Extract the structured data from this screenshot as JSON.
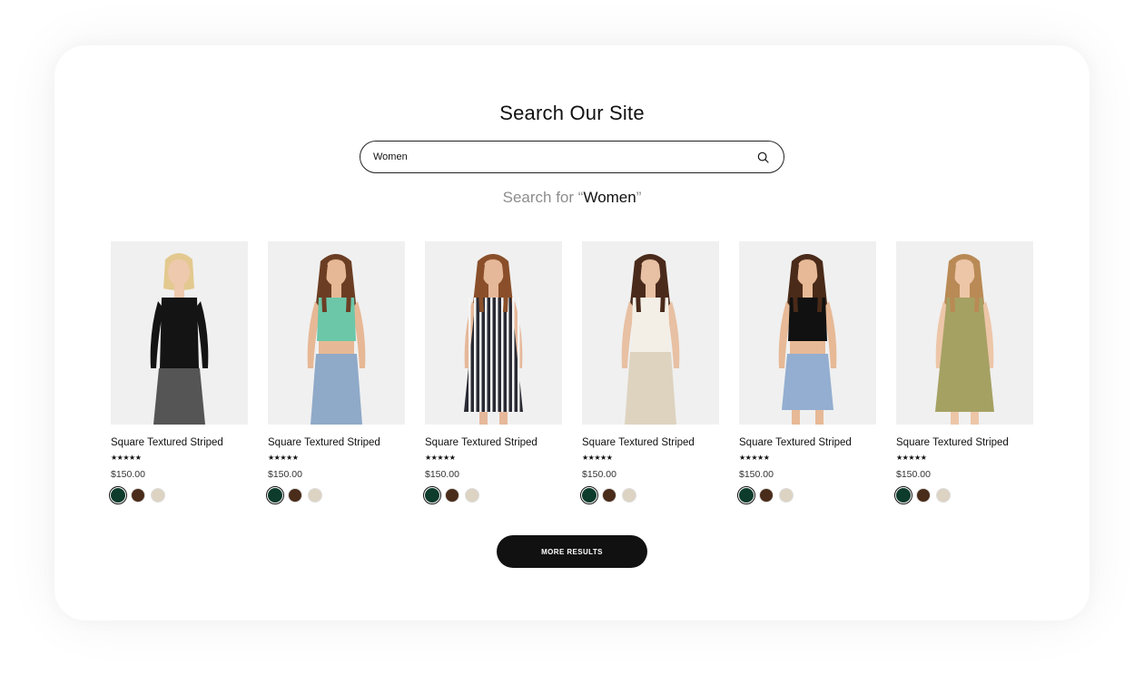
{
  "page": {
    "title": "Search Our Site"
  },
  "search": {
    "value": "Women",
    "placeholder": "",
    "icon": "search-icon"
  },
  "results": {
    "prefix": "Search for",
    "query": "Women",
    "open_quote": "“",
    "close_quote": "”"
  },
  "products": [
    {
      "name": "Square Textured Striped",
      "stars": "★★★★★",
      "price": "$150.00",
      "outfit": "black-turtleneck",
      "skin": "#eec9ad",
      "hair": "#e3c98f",
      "top": "#141414",
      "bottom": "#555555",
      "rating": 5
    },
    {
      "name": "Square Textured Striped",
      "stars": "★★★★★",
      "price": "$150.00",
      "outfit": "teal-crop",
      "skin": "#e7b895",
      "hair": "#6b3e24",
      "top": "#6cc7a9",
      "bottom": "#8fa9c8",
      "rating": 5
    },
    {
      "name": "Square Textured Striped",
      "stars": "★★★★★",
      "price": "$150.00",
      "outfit": "striped-dress",
      "skin": "#e6b89a",
      "hair": "#8a4f2a",
      "top": "#2a2a34",
      "bottom": "#2a2a34",
      "rating": 5
    },
    {
      "name": "Square Textured Striped",
      "stars": "★★★★★",
      "price": "$150.00",
      "outfit": "cream-cami",
      "skin": "#e8c0a3",
      "hair": "#4a2a1b",
      "top": "#f3efe6",
      "bottom": "#ddd3bf",
      "rating": 5
    },
    {
      "name": "Square Textured Striped",
      "stars": "★★★★★",
      "price": "$150.00",
      "outfit": "black-tank",
      "skin": "#e7b996",
      "hair": "#4a2a19",
      "top": "#111111",
      "bottom": "#93aed0",
      "rating": 5
    },
    {
      "name": "Square Textured Striped",
      "stars": "★★★★★",
      "price": "$150.00",
      "outfit": "olive-dress",
      "skin": "#edc6a8",
      "hair": "#b98a55",
      "top": "#a5a163",
      "bottom": "#a5a163",
      "rating": 5
    }
  ],
  "swatch_colors": [
    "#0d3b2c",
    "#4a2c1a",
    "#ddd3c2"
  ],
  "more_button": {
    "label": "MORE RESULTS"
  }
}
